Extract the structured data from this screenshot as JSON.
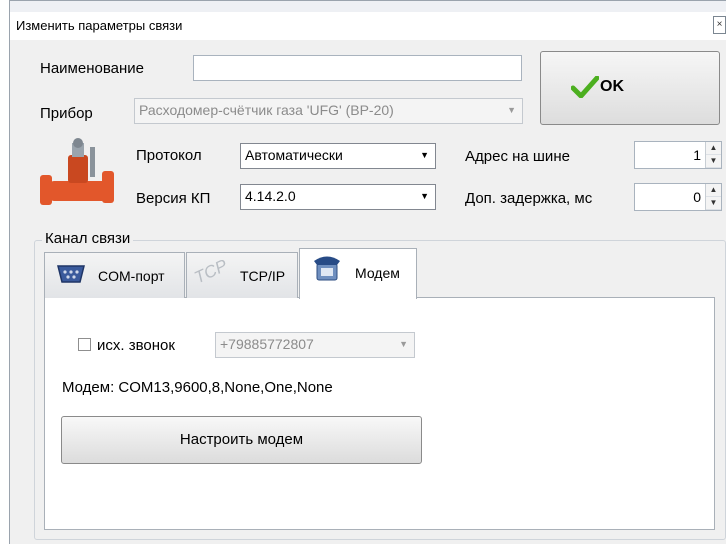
{
  "window": {
    "title": "Изменить параметры связи"
  },
  "form": {
    "name_label": "Наименование",
    "name_value": "",
    "device_label": "Прибор",
    "device_value": "Расходомер-счётчик газа 'UFG' (ВР-20)",
    "protocol_label": "Протокол",
    "protocol_value": "Автоматически",
    "version_label": "Версия КП",
    "version_value": "4.14.2.0",
    "bus_address_label": "Адрес на шине",
    "bus_address_value": "1",
    "delay_label": "Доп. задержка, мс",
    "delay_value": "0"
  },
  "ok_button": {
    "label": "OK"
  },
  "channel": {
    "group_title": "Канал связи",
    "tabs": [
      {
        "label": "COM-порт",
        "icon": "serial-port-icon"
      },
      {
        "label": "TCP/IP",
        "icon": "tcp-icon",
        "icon_text": "TCP"
      },
      {
        "label": "Модем",
        "icon": "phone-icon"
      }
    ],
    "active_tab": 2,
    "modem": {
      "outgoing_call_label": "исх. звонок",
      "outgoing_call_checked": false,
      "phone_value": "+79885772807",
      "modem_info": "Модем: COM13,9600,8,None,One,None",
      "configure_button": "Настроить модем"
    }
  },
  "colors": {
    "check_green": "#4caf1f",
    "device_orange": "#e2572b"
  }
}
